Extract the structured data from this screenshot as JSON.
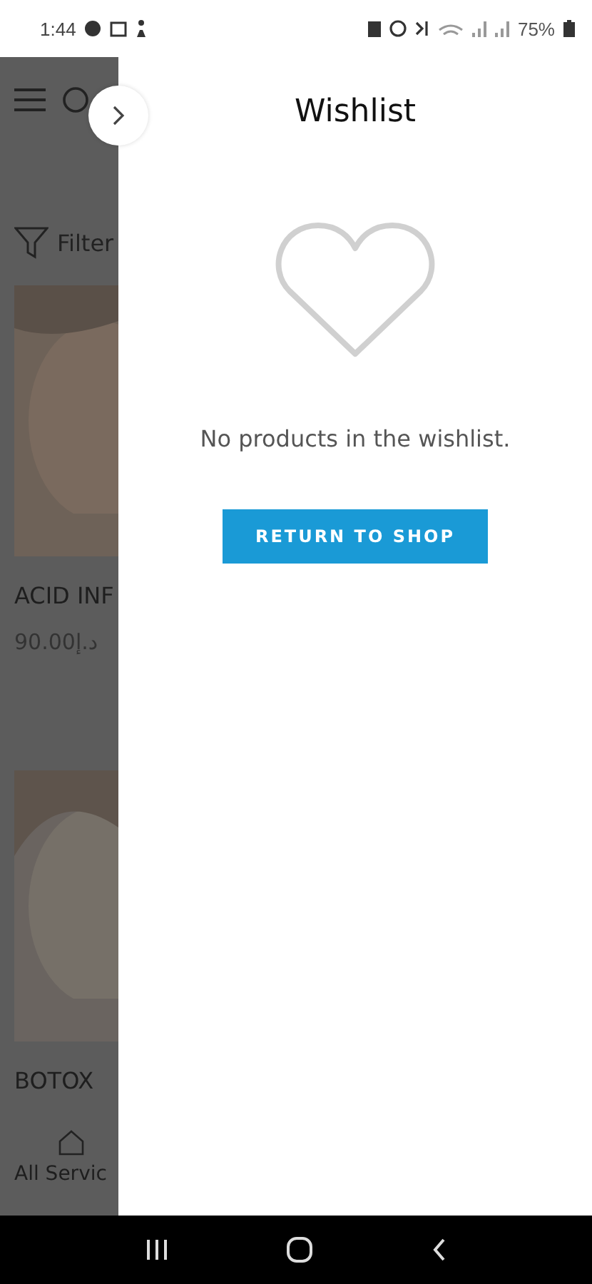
{
  "status_bar": {
    "time": "1:44",
    "battery": "75%"
  },
  "background_page": {
    "filter_label": "Filter",
    "products": [
      {
        "kind": "picture",
        "name": "ACID INF",
        "price": "90.00د.إ"
      },
      {
        "kind": "picture",
        "name": "BOTOX"
      }
    ],
    "bottom_nav": [
      {
        "label": "All Servic"
      }
    ]
  },
  "wishlist": {
    "title": "Wishlist",
    "empty_message": "No products in the wishlist.",
    "button": "RETURN TO SHOP"
  }
}
